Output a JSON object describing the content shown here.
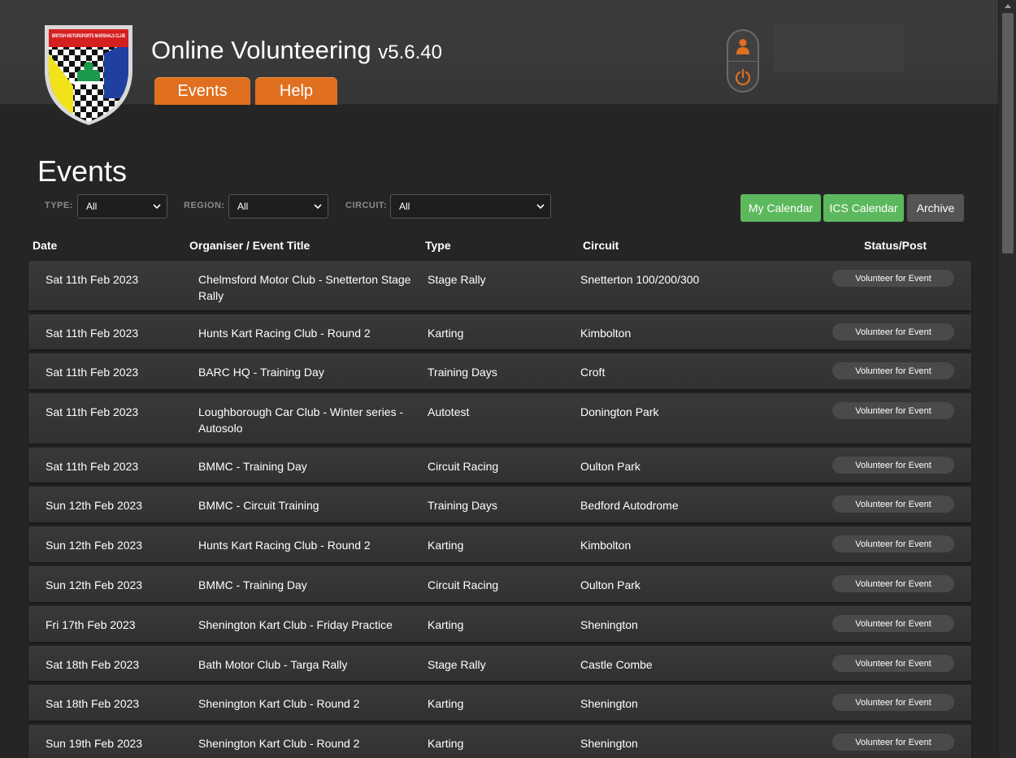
{
  "header": {
    "app_title": "Online Volunteering",
    "version": "v5.6.40",
    "logo_text": "BRITISH MOTORSPORTS MARSHALS CLUB",
    "nav": [
      {
        "label": "Events"
      },
      {
        "label": "Help"
      }
    ]
  },
  "page": {
    "heading": "Events"
  },
  "filters": {
    "type": {
      "label": "TYPE:",
      "value": "All"
    },
    "region": {
      "label": "REGION:",
      "value": "All"
    },
    "circuit": {
      "label": "CIRCUIT:",
      "value": "All"
    }
  },
  "actions": {
    "my_calendar": "My Calendar",
    "ics_calendar": "ICS Calendar",
    "archive": "Archive"
  },
  "table": {
    "columns": {
      "date": "Date",
      "title": "Organiser / Event Title",
      "type": "Type",
      "circuit": "Circuit",
      "status": "Status/Post"
    },
    "rows": [
      {
        "date": "Sat 11th Feb 2023",
        "title": "Chelmsford Motor Club - Snetterton Stage Rally",
        "type": "Stage Rally",
        "circuit": "Snetterton 100/200/300",
        "action": "Volunteer for Event"
      },
      {
        "date": "Sat 11th Feb 2023",
        "title": "Hunts Kart Racing Club - Round 2",
        "type": "Karting",
        "circuit": "Kimbolton",
        "action": "Volunteer for Event"
      },
      {
        "date": "Sat 11th Feb 2023",
        "title": "BARC HQ - Training Day",
        "type": "Training Days",
        "circuit": "Croft",
        "action": "Volunteer for Event"
      },
      {
        "date": "Sat 11th Feb 2023",
        "title": "Loughborough Car Club - Winter series - Autosolo",
        "type": "Autotest",
        "circuit": "Donington Park",
        "action": "Volunteer for Event"
      },
      {
        "date": "Sat 11th Feb 2023",
        "title": "BMMC - Training Day",
        "type": "Circuit Racing",
        "circuit": "Oulton Park",
        "action": "Volunteer for Event"
      },
      {
        "date": "Sun 12th Feb 2023",
        "title": "BMMC - Circuit Training",
        "type": "Training Days",
        "circuit": "Bedford Autodrome",
        "action": "Volunteer for Event"
      },
      {
        "date": "Sun 12th Feb 2023",
        "title": "Hunts Kart Racing Club - Round 2",
        "type": "Karting",
        "circuit": "Kimbolton",
        "action": "Volunteer for Event"
      },
      {
        "date": "Sun 12th Feb 2023",
        "title": "BMMC - Training Day",
        "type": "Circuit Racing",
        "circuit": "Oulton Park",
        "action": "Volunteer for Event"
      },
      {
        "date": "Fri 17th Feb 2023",
        "title": "Shenington Kart Club - Friday Practice",
        "type": "Karting",
        "circuit": "Shenington",
        "action": "Volunteer for Event"
      },
      {
        "date": "Sat 18th Feb 2023",
        "title": "Bath Motor Club - Targa Rally",
        "type": "Stage Rally",
        "circuit": "Castle Combe",
        "action": "Volunteer for Event"
      },
      {
        "date": "Sat 18th Feb 2023",
        "title": "Shenington Kart Club - Round 2",
        "type": "Karting",
        "circuit": "Shenington",
        "action": "Volunteer for Event"
      },
      {
        "date": "Sun 19th Feb 2023",
        "title": "Shenington Kart Club - Round 2",
        "type": "Karting",
        "circuit": "Shenington",
        "action": "Volunteer for Event"
      }
    ]
  },
  "colors": {
    "accent_orange": "#e07020",
    "button_green": "#5cb85c",
    "background": "#252525"
  }
}
